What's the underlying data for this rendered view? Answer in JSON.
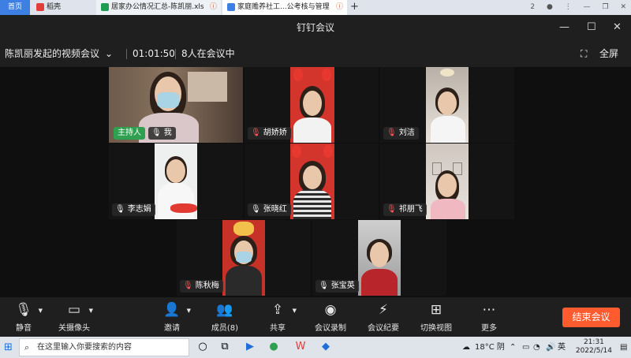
{
  "browser": {
    "tabs": [
      {
        "label": "首页"
      },
      {
        "label": "稻壳"
      },
      {
        "label": "居家办公情况汇总-陈凯丽.xls"
      },
      {
        "label": "家庭赡养社工...公考核与管理"
      }
    ],
    "add_tab": "+",
    "right_badge": "2"
  },
  "window": {
    "title": "钉钉会议"
  },
  "meeting": {
    "title": "陈凯丽发起的视频会议",
    "duration": "01:01:50",
    "participants_text": "8人在会议中",
    "fullscreen_label": "全屏"
  },
  "tiles": [
    {
      "name": "我",
      "host": true,
      "host_label": "主持人",
      "muted": false
    },
    {
      "name": "胡娇娇",
      "muted": true
    },
    {
      "name": "刘洁",
      "muted": true
    },
    {
      "name": "李志娟",
      "muted": false
    },
    {
      "name": "张晓红",
      "muted": false
    },
    {
      "name": "祁朋飞",
      "muted": true
    },
    {
      "name": "陈秋梅",
      "muted": true
    },
    {
      "name": "张宝英",
      "muted": false
    }
  ],
  "toolbar": {
    "mute": "静音",
    "camera_off": "关摄像头",
    "invite": "邀请",
    "members": "成员(8)",
    "share": "共享",
    "record": "会议录制",
    "minutes": "会议纪要",
    "switch_view": "切换视图",
    "more": "更多",
    "end": "结束会议"
  },
  "taskbar": {
    "search_placeholder": "在这里输入你要搜索的内容",
    "weather": "18°C 阴",
    "ime": "英",
    "time": "21:31",
    "date": "2022/5/14"
  },
  "colors": {
    "end_button": "#ff5b2f",
    "host_badge": "#2ea04f",
    "accent": "#3d7fe3"
  }
}
